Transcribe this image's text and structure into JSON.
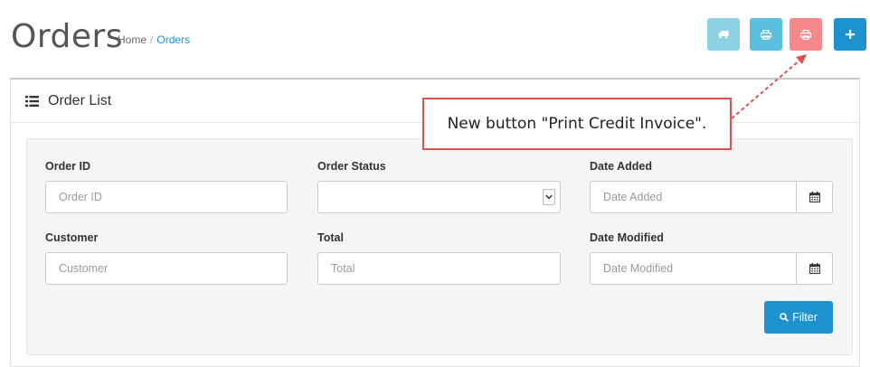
{
  "header": {
    "title": "Orders",
    "breadcrumb": [
      "Home",
      "Orders"
    ],
    "breadcrumb_separator": "/"
  },
  "toolbar": {
    "buttons": [
      {
        "name": "ship-button",
        "icon": "truck-icon",
        "color": "#8dd0e3"
      },
      {
        "name": "print-invoice-button",
        "icon": "printer-icon",
        "color": "#5bc0de"
      },
      {
        "name": "print-credit-invoice-button",
        "icon": "printer-icon",
        "color": "#f4888b"
      },
      {
        "name": "add-button",
        "icon": "plus-icon",
        "color": "#1e91cf"
      }
    ]
  },
  "panel": {
    "title": "Order List",
    "icon": "list-icon"
  },
  "filters": {
    "order_id": {
      "label": "Order ID",
      "placeholder": "Order ID"
    },
    "order_status": {
      "label": "Order Status",
      "value": ""
    },
    "date_added": {
      "label": "Date Added",
      "placeholder": "Date Added"
    },
    "customer": {
      "label": "Customer",
      "placeholder": "Customer"
    },
    "total": {
      "label": "Total",
      "placeholder": "Total"
    },
    "date_modified": {
      "label": "Date Modified",
      "placeholder": "Date Modified"
    },
    "filter_button": "Filter"
  },
  "annotation": {
    "text": "New button \"Print Credit Invoice\"."
  },
  "colors": {
    "accent": "#1e91cf",
    "danger": "#d9534f"
  }
}
